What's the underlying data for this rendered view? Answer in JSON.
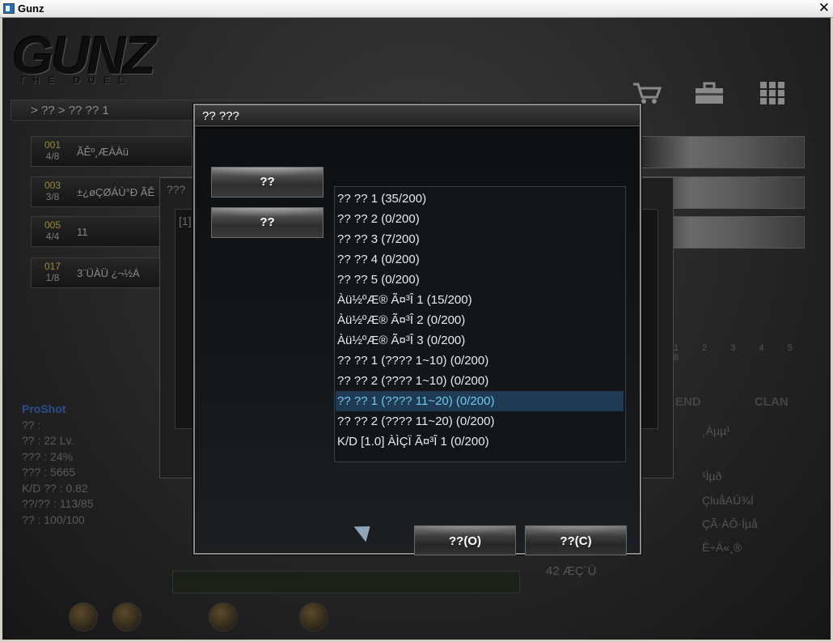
{
  "window": {
    "title": "Gunz",
    "close_glyph": "✕"
  },
  "logo": {
    "main": "GUNZ",
    "sub": "THE DUEL"
  },
  "top_icons": [
    "cart-icon",
    "toolbox-icon",
    "grid-icon"
  ],
  "breadcrumb": "> ?? > ?? ?? 1",
  "rooms": [
    {
      "num": "001",
      "count": "4/8",
      "name": "ÃÊº¸ÆÀÀü"
    },
    {
      "num": "003",
      "count": "3/8",
      "name": "±¿øÇØÁÙ°Ð ÃÊ"
    },
    {
      "num": "005",
      "count": "4/4",
      "name": "11"
    },
    {
      "num": "017",
      "count": "1/8",
      "name": "3¨ÜÀÜ ¿¬½Á"
    }
  ],
  "pager": "1 2 3 4 5 6",
  "player": {
    "name": "ProShot",
    "lines": [
      "?? :",
      "?? : 22 Lv.",
      "??? : 24%",
      "??? : 5665",
      "K/D ?? : 0.82",
      "??/?? : 113/85",
      "?? : 100/100"
    ]
  },
  "tabs": {
    "friend": "END",
    "clan": "CLAN"
  },
  "clan_list": [
    "¸Àµµ¹",
    "¹Ìµð",
    "ÇluåAÚ¾Í",
    "ÇÃ·ÀÔ·Íµå",
    "È÷Ä«¸®"
  ],
  "points": {
    "value": "42",
    "label": "ÆÇ¨Ü"
  },
  "behind_dialog": {
    "title": "???",
    "line": "[1]"
  },
  "dialog": {
    "title": "?? ???",
    "side_buttons": [
      "??",
      "??"
    ],
    "channels": [
      "?? ?? 1 (35/200)",
      "?? ?? 2 (0/200)",
      "?? ?? 3 (7/200)",
      "?? ?? 4 (0/200)",
      "?? ?? 5 (0/200)",
      "Àü½ºÆ® Ã¤³Î 1 (15/200)",
      "Àü½ºÆ® Ã¤³Î 2 (0/200)",
      "Àü½ºÆ® Ã¤³Î 3 (0/200)",
      "?? ?? 1 (???? 1~10) (0/200)",
      "?? ?? 2 (???? 1~10) (0/200)",
      "?? ?? 1 (???? 11~20) (0/200)",
      "?? ?? 2 (???? 11~20) (0/200)",
      "K/D [1.0] ÀÌÇÏ Ã¤³Î 1 (0/200)"
    ],
    "selected_index": 10,
    "ok_label": "??(O)",
    "cancel_label": "??(C)"
  },
  "colors": {
    "selected_bg": "#1f3a55",
    "selected_text": "#6fc8ea",
    "player_name": "#2c4c8c"
  }
}
